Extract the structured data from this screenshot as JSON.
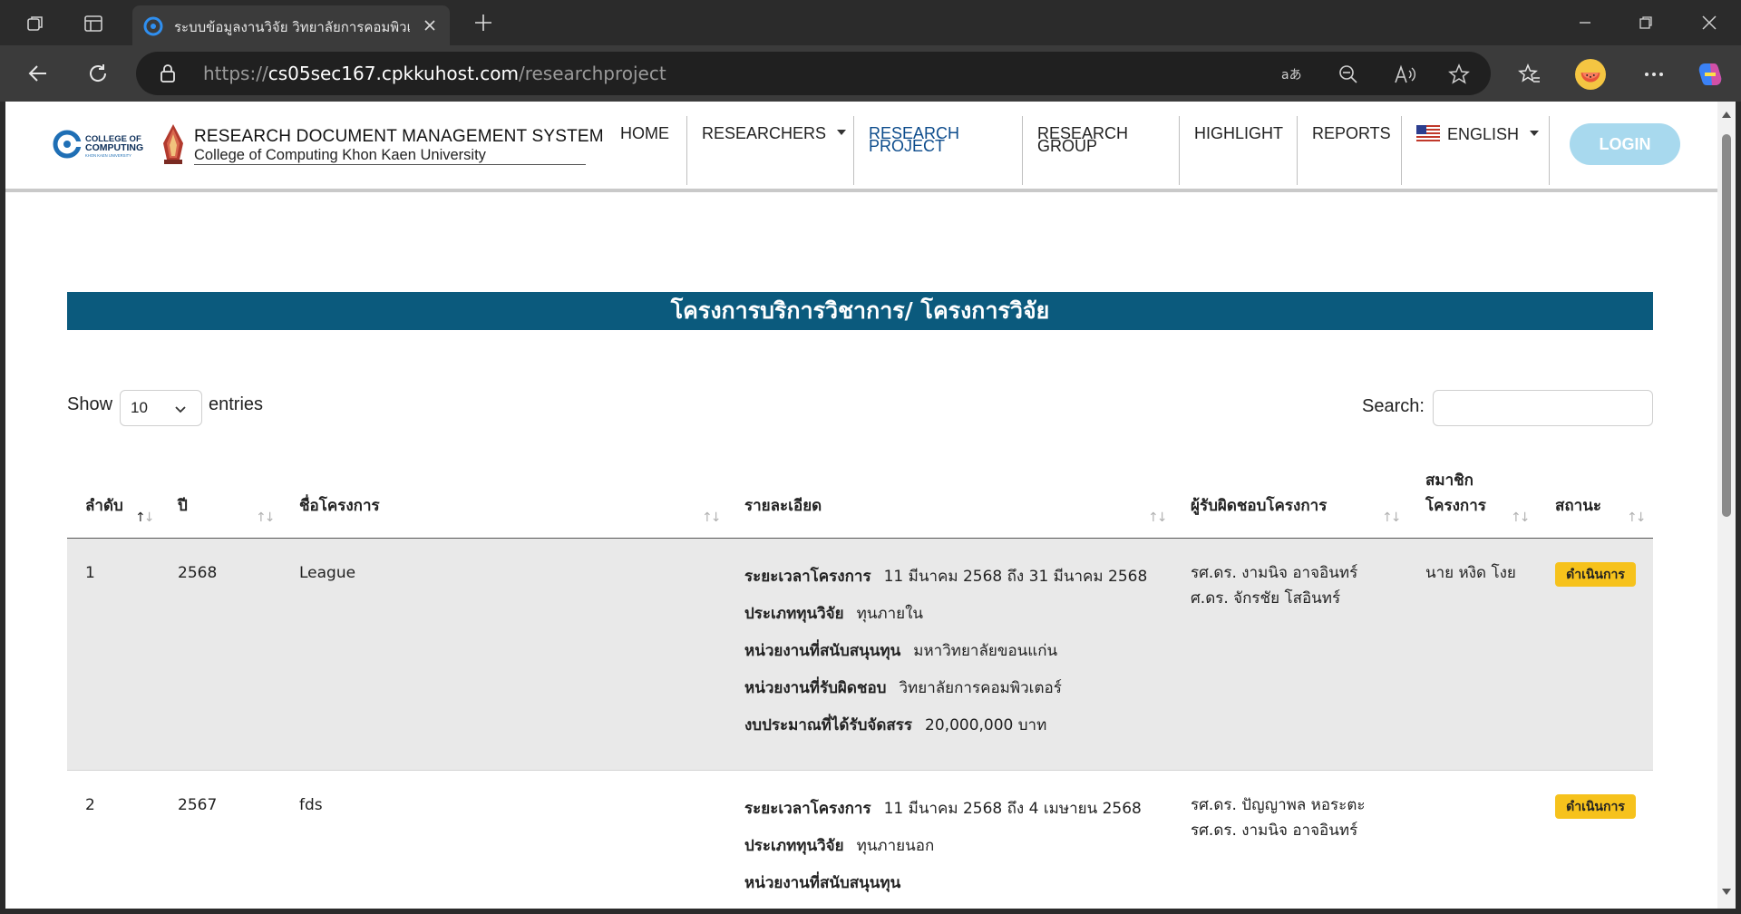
{
  "browser": {
    "tab_title": "ระบบข้อมูลงานวิจัย วิทยาลัยการคอมพิวเตอร์",
    "url_prefix": "https://",
    "url_host": "cs05sec167.cpkkuhost.com",
    "url_path": "/researchproject"
  },
  "site": {
    "brand_title": "RESEARCH DOCUMENT MANAGEMENT SYSTEM",
    "brand_subtitle": "College of Computing Khon Kaen University",
    "logo_text_top": "COLLEGE OF",
    "logo_text_bottom": "COMPUTING",
    "logo_text_small": "KHON KAEN UNIVERSITY",
    "nav": {
      "home": "HOME",
      "researchers": "RESEARCHERS",
      "research_project_1": "RESEARCH",
      "research_project_2": "PROJECT",
      "research_group_1": "RESEARCH",
      "research_group_2": "GROUP",
      "highlight": "HIGHLIGHT",
      "reports": "REPORTS",
      "language": "ENGLISH"
    },
    "login": "LOGIN"
  },
  "main": {
    "section_title": "โครงการบริการวิชาการ/ โครงการวิจัย",
    "show_label": "Show",
    "page_length": "10",
    "entries_label": "entries",
    "search_label": "Search:",
    "search_value": ""
  },
  "table": {
    "headers": {
      "no": "ลำดับ",
      "year": "ปี",
      "name": "ชื่อโครงการ",
      "detail": "รายละเอียด",
      "owner": "ผู้รับผิดชอบโครงการ",
      "members_1": "สมาชิก",
      "members_2": "โครงการ",
      "status": "สถานะ"
    },
    "rows": [
      {
        "no": "1",
        "year": "2568",
        "name": "League",
        "details": [
          {
            "label": "ระยะเวลาโครงการ",
            "value": "11 มีนาคม 2568 ถึง 31 มีนาคม 2568"
          },
          {
            "label": "ประเภททุนวิจัย",
            "value": "ทุนภายใน"
          },
          {
            "label": "หน่วยงานที่สนับสนุนทุน",
            "value": "มหาวิทยาลัยขอนแก่น"
          },
          {
            "label": "หน่วยงานที่รับผิดชอบ",
            "value": "วิทยาลัยการคอมพิวเตอร์"
          },
          {
            "label": "งบประมาณที่ได้รับจัดสรร",
            "value": "20,000,000 บาท"
          }
        ],
        "owners": [
          "รศ.ดร. งามนิจ อาจอินทร์",
          "ศ.ดร. จักรชัย โสอินทร์"
        ],
        "members": [
          "นาย หงิด โงย"
        ],
        "status": "ดำเนินการ"
      },
      {
        "no": "2",
        "year": "2567",
        "name": "fds",
        "details": [
          {
            "label": "ระยะเวลาโครงการ",
            "value": "11 มีนาคม 2568 ถึง 4 เมษายน 2568"
          },
          {
            "label": "ประเภททุนวิจัย",
            "value": "ทุนภายนอก"
          },
          {
            "label": "หน่วยงานที่สนับสนุนทุน",
            "value": ""
          }
        ],
        "owners": [
          "รศ.ดร. ปัญญาพล หอระตะ",
          "รศ.ดร. งามนิจ อาจอินทร์"
        ],
        "members": [],
        "status": "ดำเนินการ"
      }
    ]
  },
  "colors": {
    "banner": "#0b5a7d",
    "badge": "#f6c21c",
    "login": "#a8d9ee",
    "active_nav": "#0d4c8c"
  },
  "icons": [
    "workspaces-icon",
    "tab-actions-icon",
    "site-favicon",
    "close-tab-icon",
    "new-tab-icon",
    "minimize-icon",
    "restore-icon",
    "close-window-icon",
    "back-icon",
    "refresh-icon",
    "lock-icon",
    "translate-icon",
    "zoom-out-icon",
    "read-aloud-icon",
    "favorite-star-icon",
    "favorites-icon",
    "profile-avatar-icon",
    "more-icon",
    "copilot-icon"
  ]
}
